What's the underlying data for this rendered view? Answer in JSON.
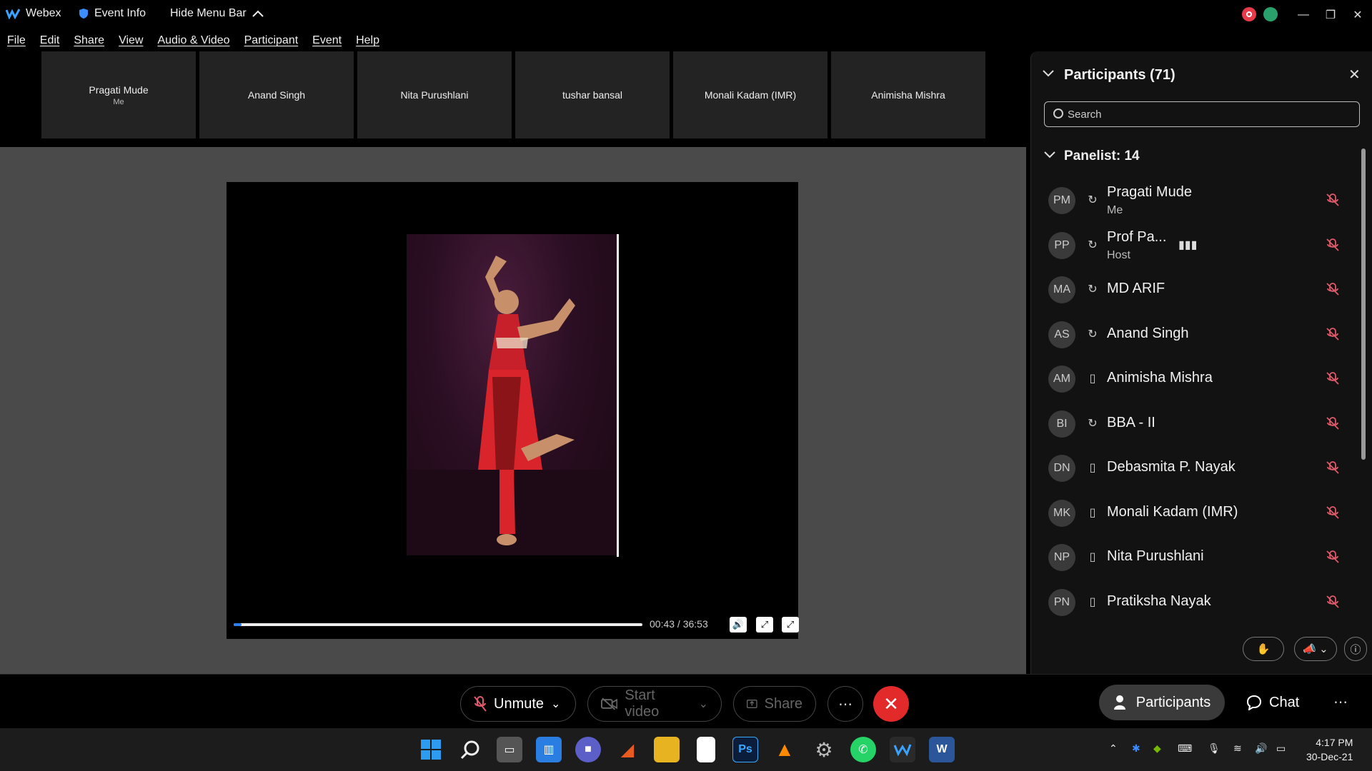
{
  "titlebar": {
    "app_name": "Webex",
    "event_info": "Event Info",
    "hide_menu": "Hide Menu Bar"
  },
  "menu": [
    "File",
    "Edit",
    "Share",
    "View",
    "Audio & Video",
    "Participant",
    "Event",
    "Help"
  ],
  "thumbnails": [
    {
      "name": "Pragati Mude",
      "sub": "Me"
    },
    {
      "name": "Anand Singh",
      "sub": ""
    },
    {
      "name": "Nita Purushlani",
      "sub": ""
    },
    {
      "name": "tushar bansal",
      "sub": ""
    },
    {
      "name": "Monali Kadam (IMR)",
      "sub": ""
    },
    {
      "name": "Animisha Mishra",
      "sub": ""
    }
  ],
  "player": {
    "time": "00:43 / 36:53",
    "progress_percent": 2
  },
  "panel": {
    "title": "Participants (71)",
    "search_placeholder": "Search",
    "section": "Panelist: 14",
    "participants": [
      {
        "initials": "PM",
        "name": "Pragati Mude",
        "sub": "Me",
        "device": "headset"
      },
      {
        "initials": "PP",
        "name": "Prof Pa...",
        "sub": "Host",
        "device": "headset"
      },
      {
        "initials": "MA",
        "name": "MD ARIF",
        "sub": "",
        "device": "headset"
      },
      {
        "initials": "AS",
        "name": "Anand Singh",
        "sub": "",
        "device": "headset"
      },
      {
        "initials": "AM",
        "name": "Animisha Mishra",
        "sub": "",
        "device": "phone"
      },
      {
        "initials": "BI",
        "name": "BBA - II",
        "sub": "",
        "device": "headset"
      },
      {
        "initials": "DN",
        "name": "Debasmita P. Nayak",
        "sub": "",
        "device": "phone"
      },
      {
        "initials": "MK",
        "name": "Monali Kadam (IMR)",
        "sub": "",
        "device": "phone"
      },
      {
        "initials": "NP",
        "name": "Nita Purushlani",
        "sub": "",
        "device": "phone"
      },
      {
        "initials": "PN",
        "name": "Pratiksha Nayak",
        "sub": "",
        "device": "phone"
      }
    ]
  },
  "bottombar": {
    "unmute": "Unmute",
    "start_video": "Start video",
    "share": "Share",
    "participants": "Participants",
    "chat": "Chat"
  },
  "taskbar": {
    "time": "4:17 PM",
    "date": "30-Dec-21"
  },
  "colors": {
    "end_call": "#e22a2a",
    "progress": "#2d7ff0",
    "mute_icon": "#e05a6a"
  }
}
